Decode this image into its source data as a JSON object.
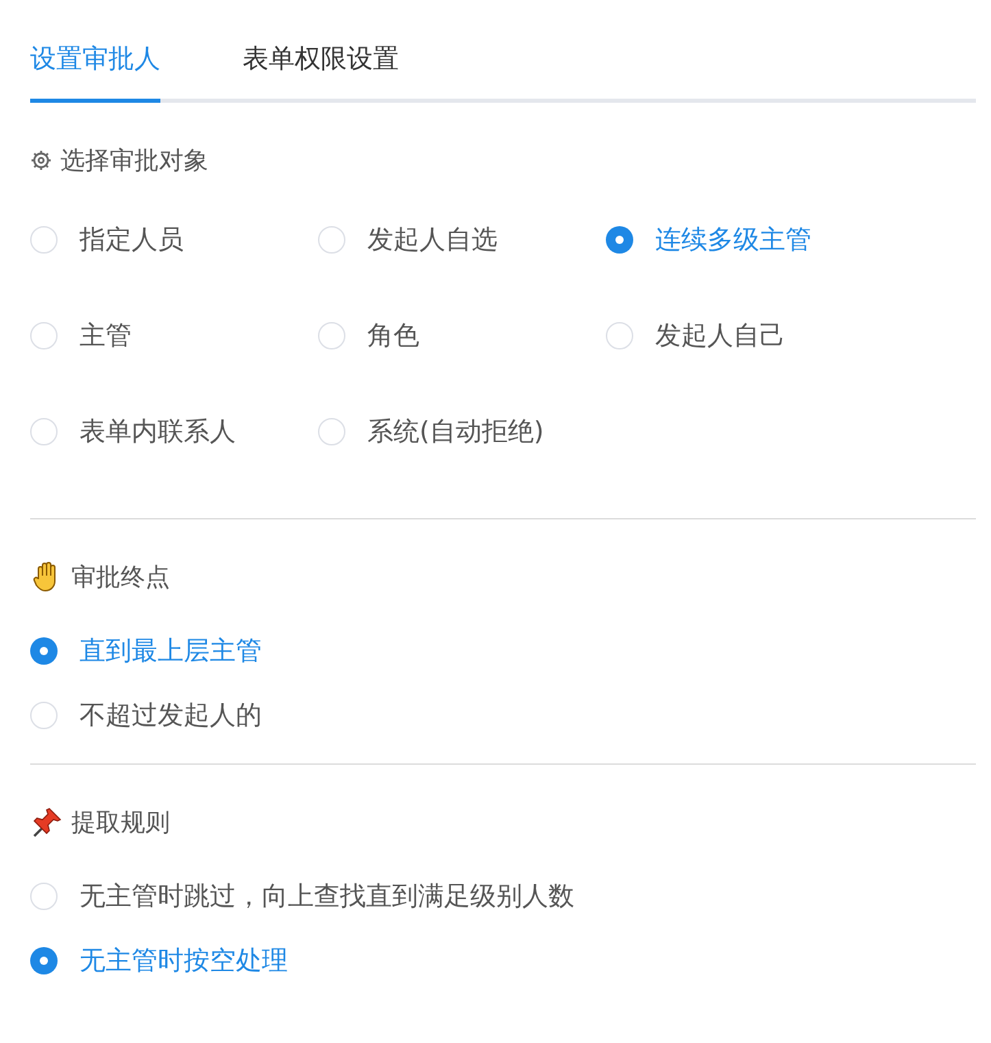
{
  "tabs": [
    {
      "label": "设置审批人",
      "selected": true
    },
    {
      "label": "表单权限设置",
      "selected": false
    }
  ],
  "sections": [
    {
      "title": "选择审批对象",
      "options": [
        {
          "label": "指定人员",
          "selected": false
        },
        {
          "label": "发起人自选",
          "selected": false
        },
        {
          "label": "连续多级主管",
          "selected": true
        },
        {
          "label": "主管",
          "selected": false
        },
        {
          "label": "角色",
          "selected": false
        },
        {
          "label": "发起人自己",
          "selected": false
        },
        {
          "label": "表单内联系人",
          "selected": false
        },
        {
          "label": "系统(自动拒绝)",
          "selected": false
        }
      ]
    },
    {
      "title": "审批终点",
      "options": [
        {
          "label": "直到最上层主管",
          "selected": true
        },
        {
          "label": "不超过发起人的",
          "selected": false
        }
      ]
    },
    {
      "title": "提取规则",
      "options": [
        {
          "label": "无主管时跳过，向上查找直到满足级别人数",
          "selected": false
        },
        {
          "label": "无主管时按空处理",
          "selected": true
        }
      ]
    }
  ]
}
